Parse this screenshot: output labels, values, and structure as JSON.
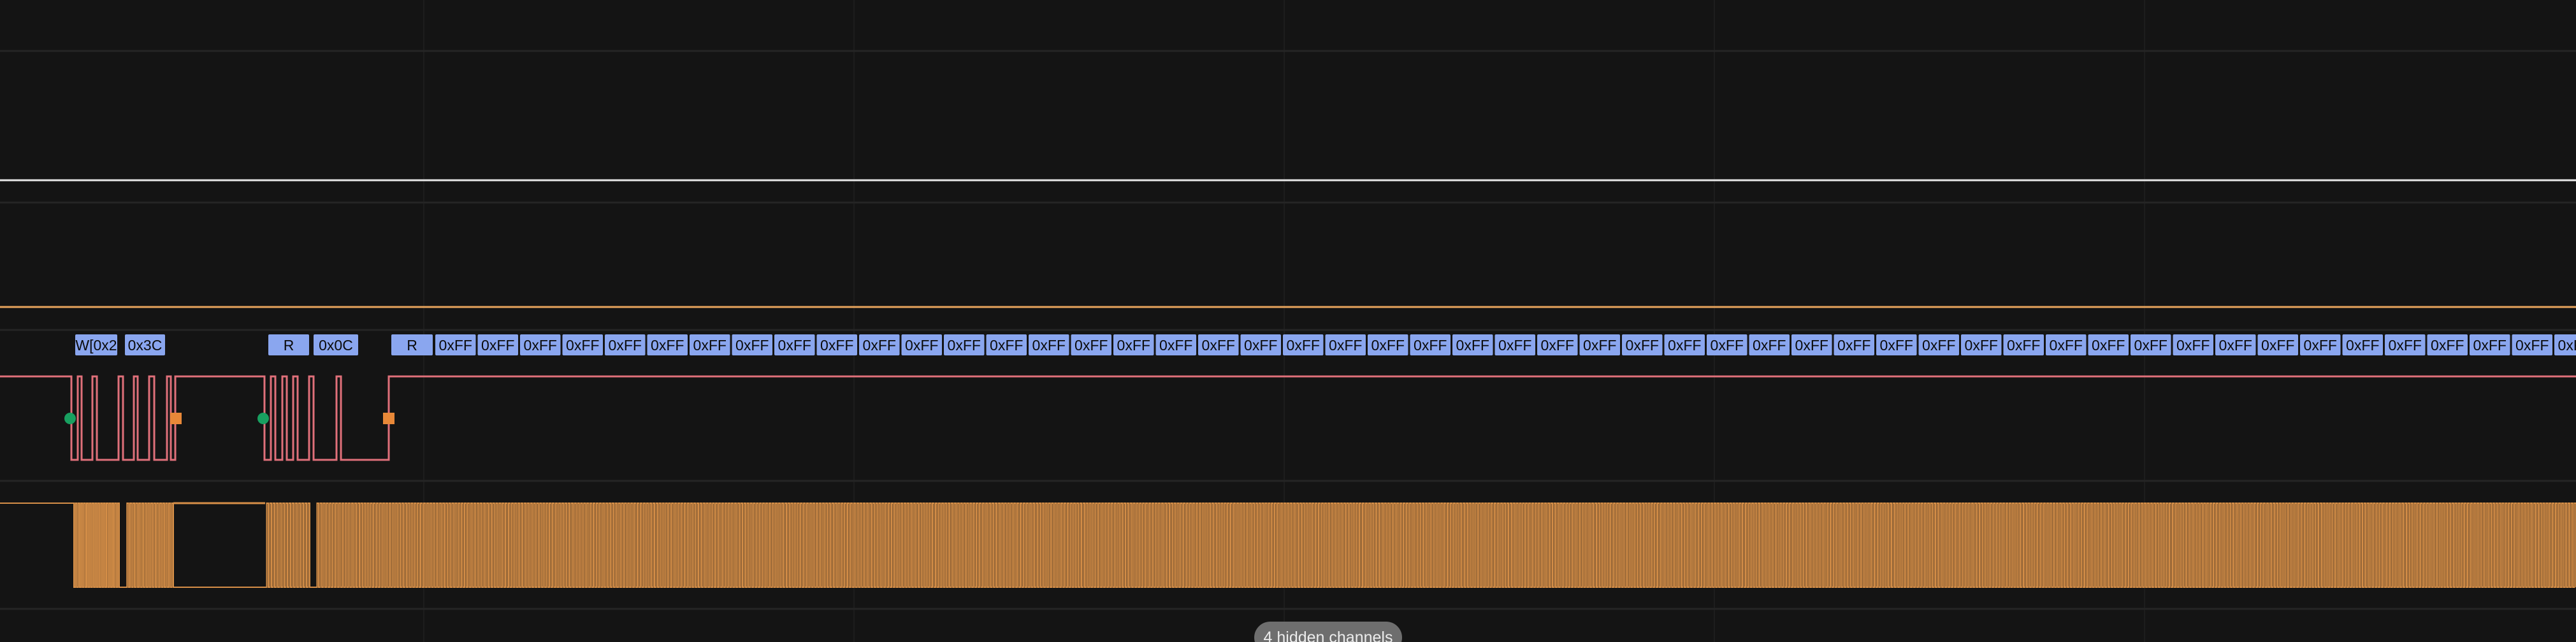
{
  "theme": {
    "background": "#141414",
    "row_divider": "#252525",
    "grid_line": "#1d1d1d",
    "white_signal": "#e8e8e8",
    "orange_signal": "#e6a35c",
    "red_signal": "#e0707a",
    "clock_signal": "#d89048",
    "label_fill": "#8aa6ef",
    "start_marker": "#18a060",
    "stop_marker": "#e88838"
  },
  "channels": [
    {
      "id": "channel-1",
      "signal": "idle-high",
      "color_key": "white_signal"
    },
    {
      "id": "channel-2",
      "signal": "idle-high",
      "color_key": "orange_signal"
    },
    {
      "id": "channel-3",
      "signal": "i2c-sda",
      "color_key": "red_signal"
    },
    {
      "id": "channel-4",
      "signal": "i2c-scl",
      "color_key": "clock_signal"
    }
  ],
  "i2c_decoder": {
    "frames": [
      "W[0x2",
      "0x3C",
      "R",
      "0x0C",
      "R"
    ],
    "trailing_byte": "0xFF",
    "trailing_count": 51
  },
  "markers": {
    "start_icon": "green-circle-start",
    "stop_icon": "orange-square-stop"
  },
  "footer": {
    "hidden_channels_label": "4 hidden channels"
  }
}
